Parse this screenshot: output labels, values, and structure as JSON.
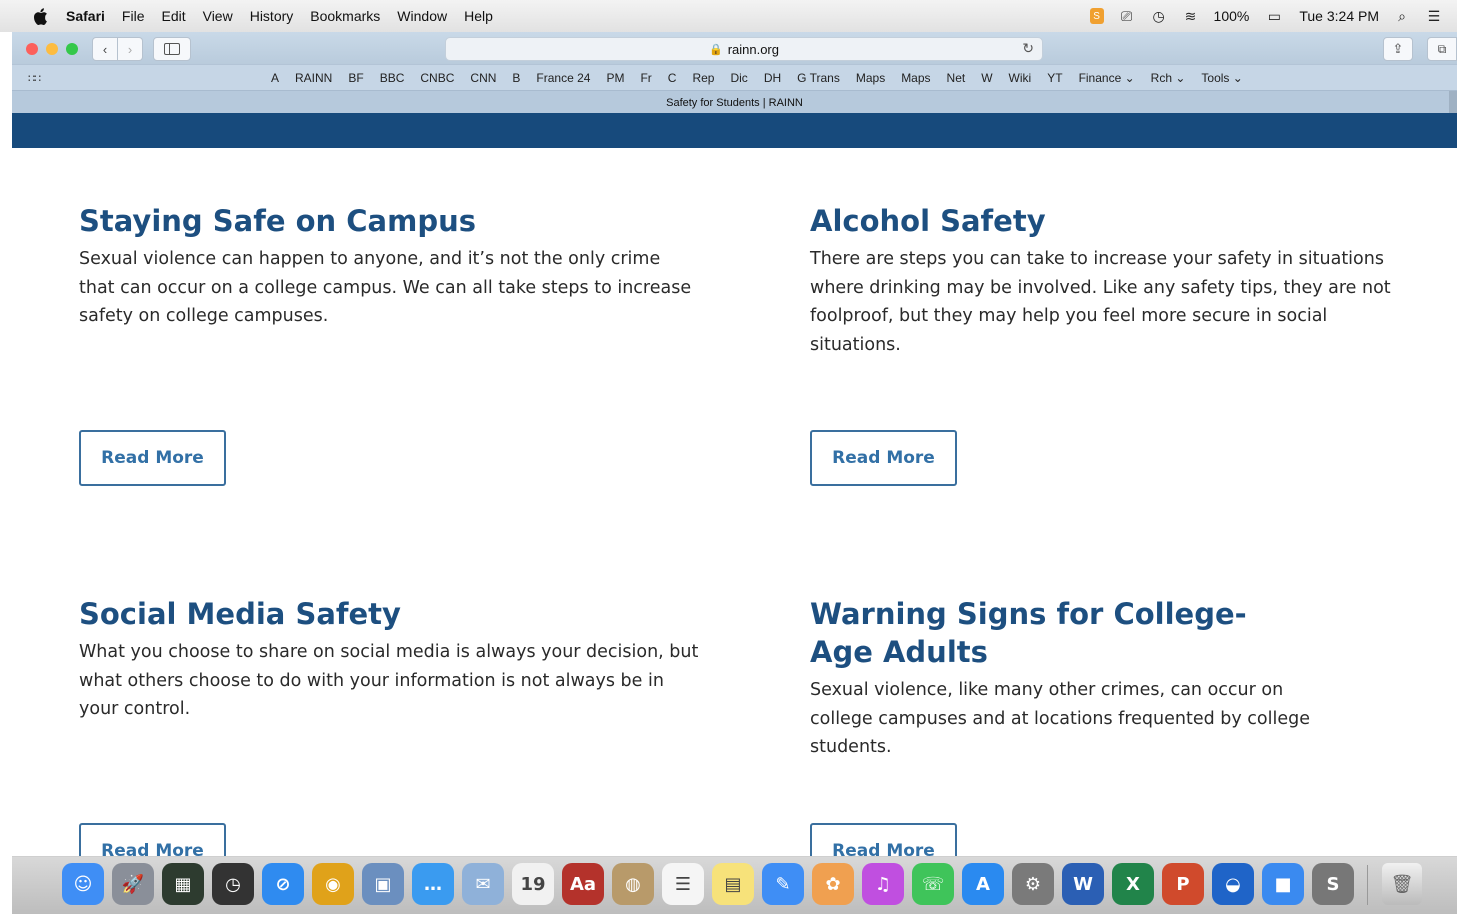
{
  "menubar": {
    "app": "Safari",
    "items": [
      "File",
      "Edit",
      "View",
      "History",
      "Bookmarks",
      "Window",
      "Help"
    ],
    "battery": "100%",
    "clock": "Tue 3:24 PM"
  },
  "toolbar": {
    "url": "rainn.org"
  },
  "favorites": [
    "A",
    "RAINN",
    "BF",
    "BBC",
    "CNBC",
    "CNN",
    "B",
    "France 24",
    "PM",
    "Fr",
    "C",
    "Rep",
    "Dic",
    "DH",
    "G Trans",
    "Maps",
    "Maps",
    "Net",
    "W",
    "Wiki",
    "YT",
    "Finance ⌄",
    "Rch ⌄",
    "Tools ⌄"
  ],
  "tab": {
    "title": "Safety for Students | RAINN"
  },
  "cards": [
    {
      "title": "Staying Safe on Campus",
      "body": "Sexual violence can happen to anyone, and it’s not the only crime that can occur on a college campus. We can all take steps to increase safety on college campuses.",
      "button": "Read More"
    },
    {
      "title": "Alcohol Safety",
      "body": "There are steps you can take to increase your safety in situations where drinking may be involved. Like any safety tips, they are not foolproof, but they may help you feel more secure in social situations.",
      "button": "Read More"
    },
    {
      "title": "Social Media Safety",
      "body": "What you choose to share on social media is always your decision, but what others choose to do with your information is not always be in your control.",
      "button": "Read More"
    },
    {
      "title": "Warning Signs for College-Age Adults",
      "body": "Sexual violence, like many other crimes, can occur on college campuses and at locations frequented by college students.",
      "button": "Read More"
    }
  ],
  "dock": {
    "icons": [
      {
        "name": "finder-icon",
        "color": "#3f8ef5",
        "glyph": "☺"
      },
      {
        "name": "launchpad-icon",
        "color": "#8a8f99",
        "glyph": "🚀"
      },
      {
        "name": "mission-control-icon",
        "color": "#2d3b2f",
        "glyph": "▦"
      },
      {
        "name": "dashboard-icon",
        "color": "#333333",
        "glyph": "◷"
      },
      {
        "name": "safari-icon",
        "color": "#2f8bf0",
        "glyph": "⊘"
      },
      {
        "name": "chrome-icon",
        "color": "#e0a21a",
        "glyph": "◉"
      },
      {
        "name": "preview-icon",
        "color": "#6b8fbf",
        "glyph": "▣"
      },
      {
        "name": "messages-icon",
        "color": "#3a9bf0",
        "glyph": "…"
      },
      {
        "name": "mail-icon",
        "color": "#8fb1d9",
        "glyph": "✉"
      },
      {
        "name": "calendar-icon",
        "color": "#f1f1f1",
        "glyph": "19"
      },
      {
        "name": "dictionary-icon",
        "color": "#b4322b",
        "glyph": "Aa"
      },
      {
        "name": "contacts-icon",
        "color": "#b89a6a",
        "glyph": "◍"
      },
      {
        "name": "reminders-icon",
        "color": "#f5f5f5",
        "glyph": "☰"
      },
      {
        "name": "notes-icon",
        "color": "#f7e27a",
        "glyph": "▤"
      },
      {
        "name": "pages-icon",
        "color": "#3f8ef5",
        "glyph": "✎"
      },
      {
        "name": "photos-icon",
        "color": "#f0a050",
        "glyph": "✿"
      },
      {
        "name": "itunes-icon",
        "color": "#c04fe0",
        "glyph": "♫"
      },
      {
        "name": "facetime-icon",
        "color": "#3fc45a",
        "glyph": "☏"
      },
      {
        "name": "app-store-icon",
        "color": "#2a8af0",
        "glyph": "A"
      },
      {
        "name": "system-preferences-icon",
        "color": "#7a7a7a",
        "glyph": "⚙"
      },
      {
        "name": "word-icon",
        "color": "#2b5fb4",
        "glyph": "W"
      },
      {
        "name": "excel-icon",
        "color": "#21844a",
        "glyph": "X"
      },
      {
        "name": "powerpoint-icon",
        "color": "#d04a2c",
        "glyph": "P"
      },
      {
        "name": "google-earth-icon",
        "color": "#1f64c8",
        "glyph": "◒"
      },
      {
        "name": "zoom-icon",
        "color": "#3a8af0",
        "glyph": "■"
      },
      {
        "name": "scrivener-icon",
        "color": "#777777",
        "glyph": "S"
      }
    ]
  }
}
